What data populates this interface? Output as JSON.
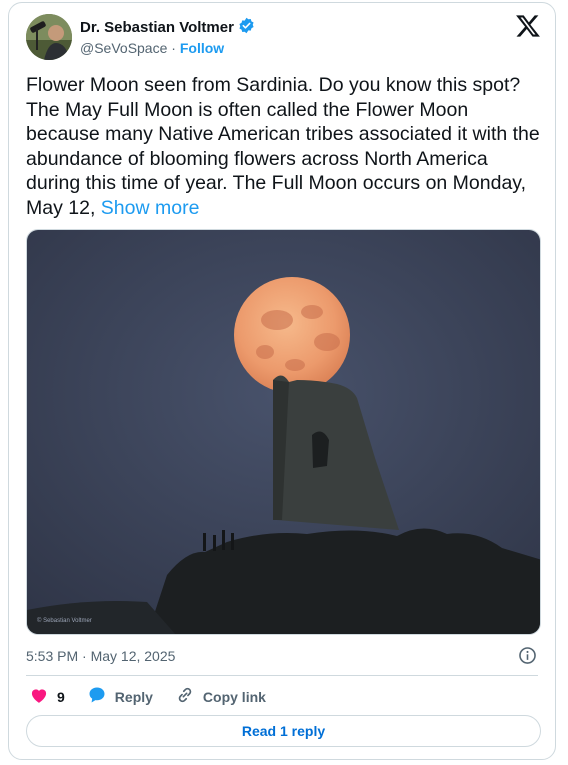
{
  "author": {
    "name": "Dr. Sebastian Voltmer",
    "handle": "@SeVoSpace",
    "separator": "·",
    "follow_label": "Follow"
  },
  "tweet": {
    "text": "Flower Moon seen from Sardinia. Do you know this spot? The May Full Moon is often called the Flower Moon because many Native American tribes associated it with the abundance of blooming flowers across North America during this time of year. The Full Moon occurs on Monday, May 12, ",
    "show_more": "Show more",
    "timestamp": "5:53 PM · May 12, 2025",
    "media_watermark": "© Sebastian Voltmer"
  },
  "actions": {
    "likes_count": "9",
    "reply_label": "Reply",
    "copy_link_label": "Copy link",
    "read_replies_label": "Read 1 reply"
  },
  "colors": {
    "accent": "#1d9bf0",
    "like": "#f91880",
    "text": "#0f1419",
    "muted": "#536471",
    "border": "#cfd9de"
  },
  "icons": {
    "verified": "verified-badge-icon",
    "logo": "x-logo-icon",
    "info": "info-icon",
    "like": "heart-icon",
    "reply": "speech-bubble-icon",
    "copy": "link-icon"
  }
}
